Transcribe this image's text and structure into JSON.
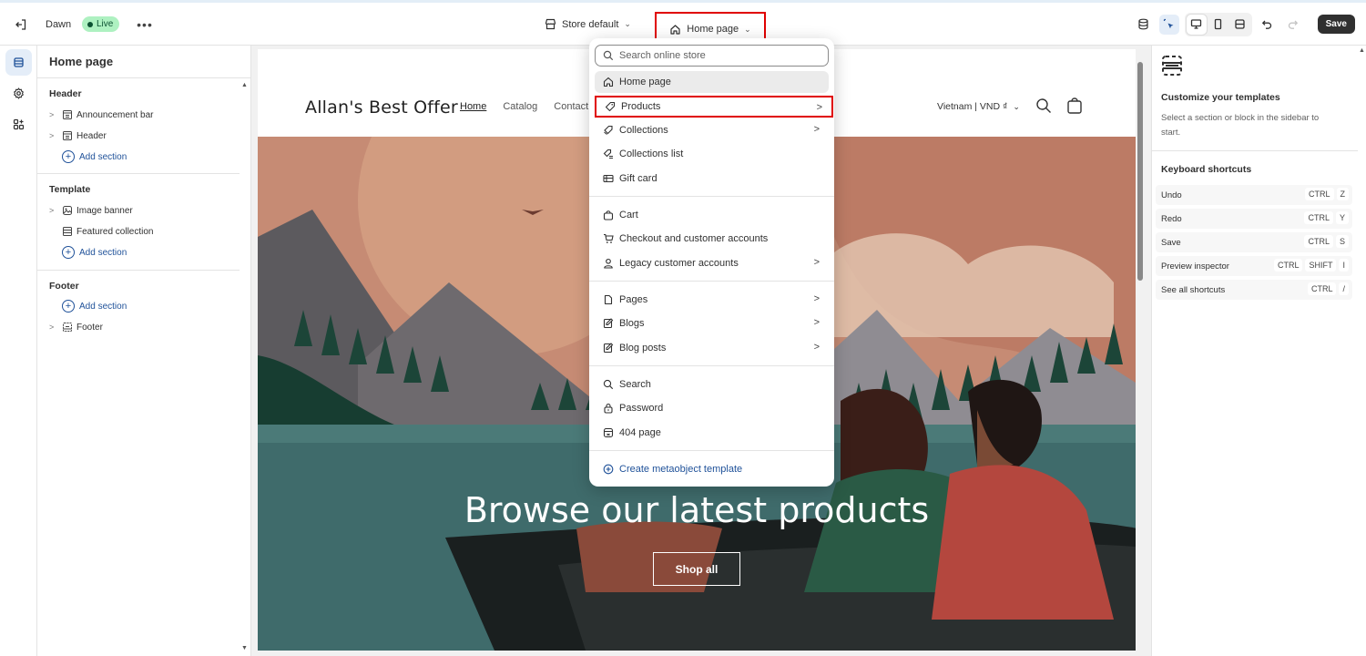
{
  "topbar": {
    "theme_name": "Dawn",
    "live_label": "Live",
    "more_label": "•••",
    "store_default": "Store default",
    "template_selector": "Home page",
    "save_label": "Save"
  },
  "sidebar": {
    "title": "Home page",
    "groups": {
      "header": "Header",
      "template": "Template",
      "footer": "Footer"
    },
    "items": {
      "announcement_bar": "Announcement bar",
      "header": "Header",
      "image_banner": "Image banner",
      "featured_collection": "Featured collection",
      "footer": "Footer"
    },
    "add_section": "Add section"
  },
  "preview": {
    "logo": "Allan's Best Offer",
    "nav": [
      "Home",
      "Catalog",
      "Contact"
    ],
    "locale": "Vietnam | VND ₫",
    "banner_heading": "Browse our latest products",
    "shop_all": "Shop all"
  },
  "dropdown": {
    "search_placeholder": "Search online store",
    "items": [
      {
        "label": "Home page",
        "icon": "home-icon"
      },
      {
        "label": "Products",
        "icon": "tag-icon"
      },
      {
        "label": "Collections",
        "icon": "collection-icon"
      },
      {
        "label": "Collections list",
        "icon": "collections-list-icon"
      },
      {
        "label": "Gift card",
        "icon": "gift-card-icon"
      },
      {
        "label": "Cart",
        "icon": "bag-icon"
      },
      {
        "label": "Checkout and customer accounts",
        "icon": "cart-icon"
      },
      {
        "label": "Legacy customer accounts",
        "icon": "person-icon"
      },
      {
        "label": "Pages",
        "icon": "page-icon"
      },
      {
        "label": "Blogs",
        "icon": "blog-icon"
      },
      {
        "label": "Blog posts",
        "icon": "blog-post-icon"
      },
      {
        "label": "Search",
        "icon": "search-icon"
      },
      {
        "label": "Password",
        "icon": "lock-icon"
      },
      {
        "label": "404 page",
        "icon": "404-icon"
      },
      {
        "label": "Create metaobject template",
        "icon": "plus-circle-icon"
      }
    ]
  },
  "right_panel": {
    "title": "Customize your templates",
    "description": "Select a section or block in the sidebar to start.",
    "shortcuts_title": "Keyboard shortcuts",
    "shortcuts": [
      {
        "label": "Undo",
        "keys": [
          "CTRL",
          "Z"
        ]
      },
      {
        "label": "Redo",
        "keys": [
          "CTRL",
          "Y"
        ]
      },
      {
        "label": "Save",
        "keys": [
          "CTRL",
          "S"
        ]
      },
      {
        "label": "Preview inspector",
        "keys": [
          "CTRL",
          "SHIFT",
          "I"
        ]
      },
      {
        "label": "See all shortcuts",
        "keys": [
          "CTRL",
          "/"
        ]
      }
    ]
  },
  "colors": {
    "accent_link": "#1f5199",
    "highlight_box": "#e00000",
    "live_badge": "#aef1c1",
    "save_button": "#303030"
  }
}
